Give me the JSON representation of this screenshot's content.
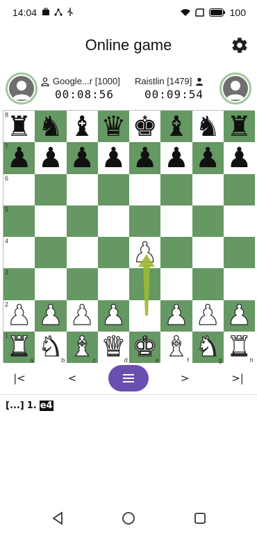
{
  "status_bar": {
    "time": "14:04",
    "battery_text": "100"
  },
  "header": {
    "title": "Online game"
  },
  "players": {
    "left": {
      "name": "Google...r [1000]",
      "clock": "00:08:56"
    },
    "right": {
      "name": "Raistlin [1479]",
      "clock": "00:09:54"
    }
  },
  "board": {
    "rank_labels": [
      "8",
      "7",
      "6",
      "5",
      "4",
      "3",
      "2",
      "1"
    ],
    "file_labels": [
      "a",
      "b",
      "c",
      "d",
      "e",
      "f",
      "g",
      "h"
    ],
    "last_move": "e2-e4"
  },
  "nav": {
    "first": "|<",
    "prev": "<",
    "next": ">",
    "last": ">|"
  },
  "moves": {
    "prefix": "[...]",
    "number": "1.",
    "current": "e4"
  },
  "colors": {
    "dark_square": "#659862",
    "light_square": "#ffffff",
    "fab": "#6a4fb0",
    "avatar_ring": "#9dc99d"
  }
}
